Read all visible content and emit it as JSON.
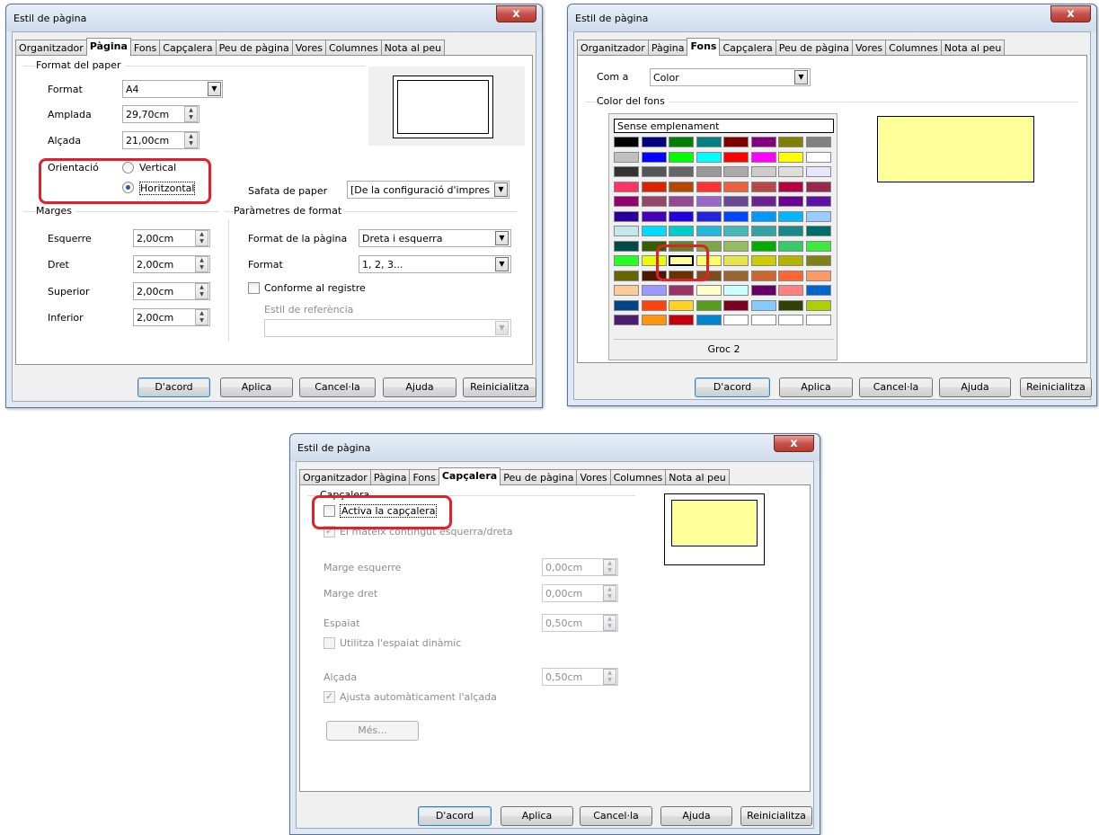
{
  "tabs": [
    "Organitzador",
    "Pàgina",
    "Fons",
    "Capçalera",
    "Peu de pàgina",
    "Vores",
    "Columnes",
    "Nota al peu"
  ],
  "buttons": {
    "ok": "D'acord",
    "apply": "Aplica",
    "cancel": "Cancel·la",
    "help": "Ajuda",
    "reset": "Reinicialitza"
  },
  "dialog1": {
    "title": "Estil de pàgina",
    "close": "x",
    "paper_format_section": "Format del paper",
    "format_label": "Format",
    "format_value": "A4",
    "width_label": "Amplada",
    "width_value": "29,70cm",
    "height_label": "Alçada",
    "height_value": "21,00cm",
    "orientation_label": "Orientació",
    "vertical_label": "Vertical",
    "horizontal_label": "Horitzontal",
    "paper_tray_label": "Safata de paper",
    "paper_tray_value": "[De la configuració d'impres",
    "margins_section": "Marges",
    "left_label": "Esquerre",
    "left_value": "2,00cm",
    "right_label": "Dret",
    "right_value": "2,00cm",
    "top_label": "Superior",
    "top_value": "2,00cm",
    "bottom_label": "Inferior",
    "bottom_value": "2,00cm",
    "layout_section": "Paràmetres de format",
    "page_layout_label": "Format de la pàgina",
    "page_layout_value": "Dreta i esquerra",
    "numbering_label": "Format",
    "numbering_value": "1, 2, 3...",
    "register_label": "Conforme al registre",
    "reference_style_label": "Estil de referència"
  },
  "dialog2": {
    "title": "Estil de pàgina",
    "close": "x",
    "as_label": "Com a",
    "as_value": "Color",
    "bg_color_section": "Color del fons",
    "no_fill": "Sense emplenament",
    "selected_color_name": "Groc 2",
    "preview_color": "#ffff99",
    "palette": [
      [
        "#000000",
        "#000080",
        "#008000",
        "#008080",
        "#800000",
        "#800080",
        "#808000",
        "#808080"
      ],
      [
        "#c0c0c0",
        "#0000ff",
        "#00ff00",
        "#00ffff",
        "#ff0000",
        "#ff00ff",
        "#ffff00",
        "#ffffff"
      ],
      [
        "#333333",
        "#555555",
        "#666666",
        "#999999",
        "#aaaaaa",
        "#cccccc",
        "#dddddd",
        "#e6e6ff"
      ],
      [
        "#ff3366",
        "#dc2300",
        "#b84700",
        "#ff3333",
        "#eb613d",
        "#b84747",
        "#b80047",
        "#99284c"
      ],
      [
        "#94006b",
        "#94476b",
        "#944794",
        "#9966cc",
        "#6b4794",
        "#6b2394",
        "#6b0094",
        "#5e11a6"
      ],
      [
        "#280099",
        "#4700b8",
        "#2300dc",
        "#2323dc",
        "#0047ff",
        "#0099ff",
        "#00b8ff",
        "#99ccff"
      ],
      [
        "#c2e8ec",
        "#00dcff",
        "#00cccc",
        "#23b8dc",
        "#47b8b8",
        "#33a3a3",
        "#198a8a",
        "#006b6b"
      ],
      [
        "#004a4a",
        "#355e00",
        "#5c8526",
        "#7da647",
        "#94bd5e",
        "#00ae00",
        "#33cc66",
        "#3deb3d"
      ],
      [
        "#23ff23",
        "#e6ff00",
        "#ffff99",
        "#ffff66",
        "#e6e64c",
        "#cccc00",
        "#b3b300",
        "#808019"
      ],
      [
        "#666600",
        "#4c1900",
        "#663300",
        "#804c19",
        "#996633",
        "#cc6633",
        "#ff6633",
        "#ff9966"
      ],
      [
        "#ffcc99",
        "#9999ff",
        "#993366",
        "#ffffcc",
        "#ccffff",
        "#660066",
        "#ff8080",
        "#0066cc"
      ],
      [
        "#004586",
        "#ff420e",
        "#ffd320",
        "#579d1c",
        "#7e0021",
        "#83caff",
        "#314004",
        "#aecf00"
      ],
      [
        "#4b1f6f",
        "#ff950e",
        "#c5000b",
        "#0084d1",
        "#ffffff",
        "#ffffff",
        "#ffffff",
        "#ffffff"
      ]
    ]
  },
  "dialog3": {
    "title": "Estil de pàgina",
    "close": "x",
    "header_section": "Capçalera",
    "activate_header": "Activa la capçalera",
    "same_content": "El mateix contingut esquerra/dreta",
    "left_margin_label": "Marge esquerre",
    "left_margin_value": "0,00cm",
    "right_margin_label": "Marge dret",
    "right_margin_value": "0,00cm",
    "spacing_label": "Espaiat",
    "spacing_value": "0,50cm",
    "dynamic_spacing": "Utilitza l'espaiat dinàmic",
    "height_label": "Alçada",
    "height_value": "0,50cm",
    "autofit_height": "Ajusta automàticament l'alçada",
    "more_button": "Més...",
    "preview_color": "#ffff99"
  }
}
